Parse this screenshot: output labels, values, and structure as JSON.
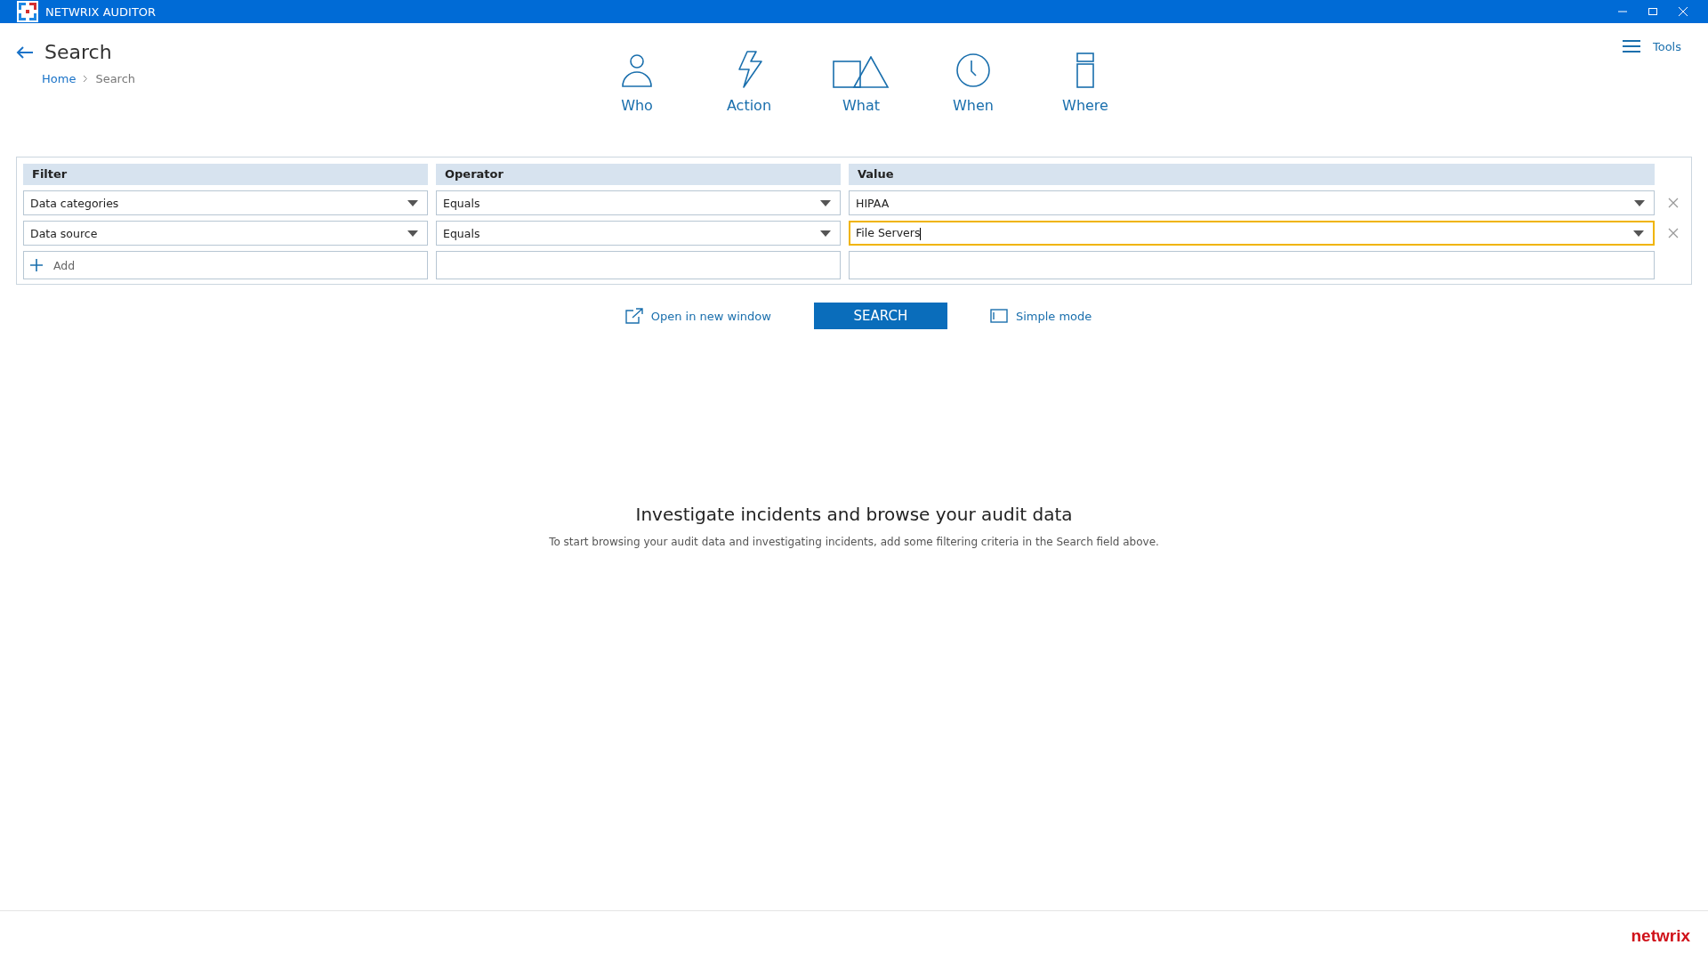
{
  "window": {
    "title": "NETWRIX AUDITOR"
  },
  "header": {
    "title": "Search",
    "breadcrumb": [
      "Home",
      "Search"
    ]
  },
  "nav": [
    {
      "kind": "who",
      "label": "Who"
    },
    {
      "kind": "action",
      "label": "Action"
    },
    {
      "kind": "what",
      "label": "What"
    },
    {
      "kind": "when",
      "label": "When"
    },
    {
      "kind": "where",
      "label": "Where"
    }
  ],
  "tools": {
    "label": "Tools"
  },
  "filter_table": {
    "columns": [
      "Filter",
      "Operator",
      "Value"
    ],
    "rows": [
      {
        "filter": "Data categories",
        "operator": "Equals",
        "value": "HIPAA",
        "focused": false
      },
      {
        "filter": "Data source",
        "operator": "Equals",
        "value": "File Servers",
        "focused": true
      }
    ],
    "add_label": "Add"
  },
  "actions": {
    "open_new_window": "Open in new window",
    "search": "SEARCH",
    "simple_mode": "Simple mode"
  },
  "empty_state": {
    "heading": "Investigate incidents and browse your audit data",
    "text": "To start browsing your audit data and investigating incidents, add some filtering criteria in the Search field above."
  },
  "footer": {
    "logo": "netwrix"
  }
}
